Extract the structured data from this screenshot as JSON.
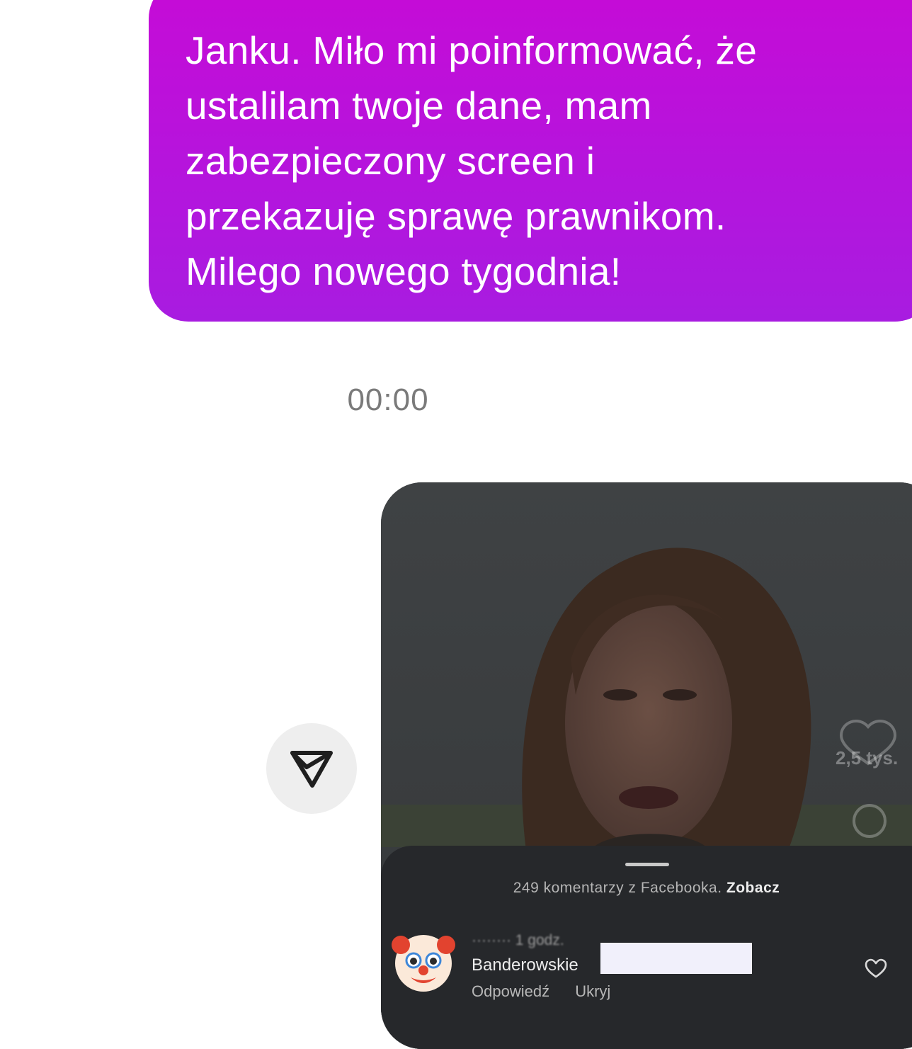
{
  "message": {
    "text": "Janku. Miło mi poinformować, że\nustalilam twoje dane, mam\nzabezpieczony screen i\nprzekazuję sprawę prawnikom.\nMilego nowego tygodnia!"
  },
  "timestamp": "00:00",
  "colors": {
    "bubble_top": "#c60bd6",
    "bubble_bottom": "#a81ce0",
    "sheet_background": "#26282b"
  },
  "shared_reel": {
    "side_likes_count": "2,5 tys.",
    "comments_sheet": {
      "facebook_comments_text": "249 komentarzy z Facebooka.",
      "facebook_comments_link": "Zobacz",
      "comment": {
        "avatar_emoji": "clown-face",
        "meta": "········ 1 godz.",
        "text": "Banderowskie",
        "reply_label": "Odpowiedź",
        "hide_label": "Ukryj"
      }
    }
  },
  "icons": {
    "share": "paper-plane-icon",
    "side_like": "heart-icon",
    "side_comment": "comment-icon",
    "comment_like": "heart-icon"
  }
}
